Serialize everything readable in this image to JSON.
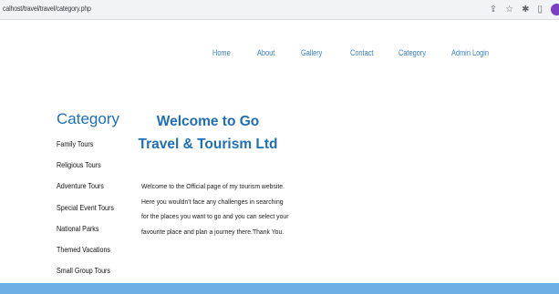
{
  "browser": {
    "url": "calhost/travel/travel/category.php",
    "icons": [
      "share-icon",
      "star-icon",
      "pin-icon",
      "sidebar-icon",
      "profile-avatar"
    ]
  },
  "nav": {
    "items": [
      "Home",
      "About",
      "Gallery",
      "Contact",
      "Category",
      "Admin Login"
    ]
  },
  "sidebar": {
    "title": "Category",
    "items": [
      "Family Tours",
      "Religious Tours",
      "Adventure Tours",
      "Special Event Tours",
      "National Parks",
      "Themed Vacations",
      "Small Group Tours"
    ]
  },
  "main": {
    "title": "Welcome to Go Travel & Tourism Ltd",
    "paragraph_lines": [
      "Welcome to the Official page of my tourism website.",
      "Here you wouldn't face any challenges in searching",
      "for the places you want to go and you can select your",
      "favourite place and plan a journey there.Thank You."
    ]
  },
  "colors": {
    "accent": "#1e6fb8",
    "nav_link": "#3a7fc1",
    "footer": "#6fb0e4"
  }
}
